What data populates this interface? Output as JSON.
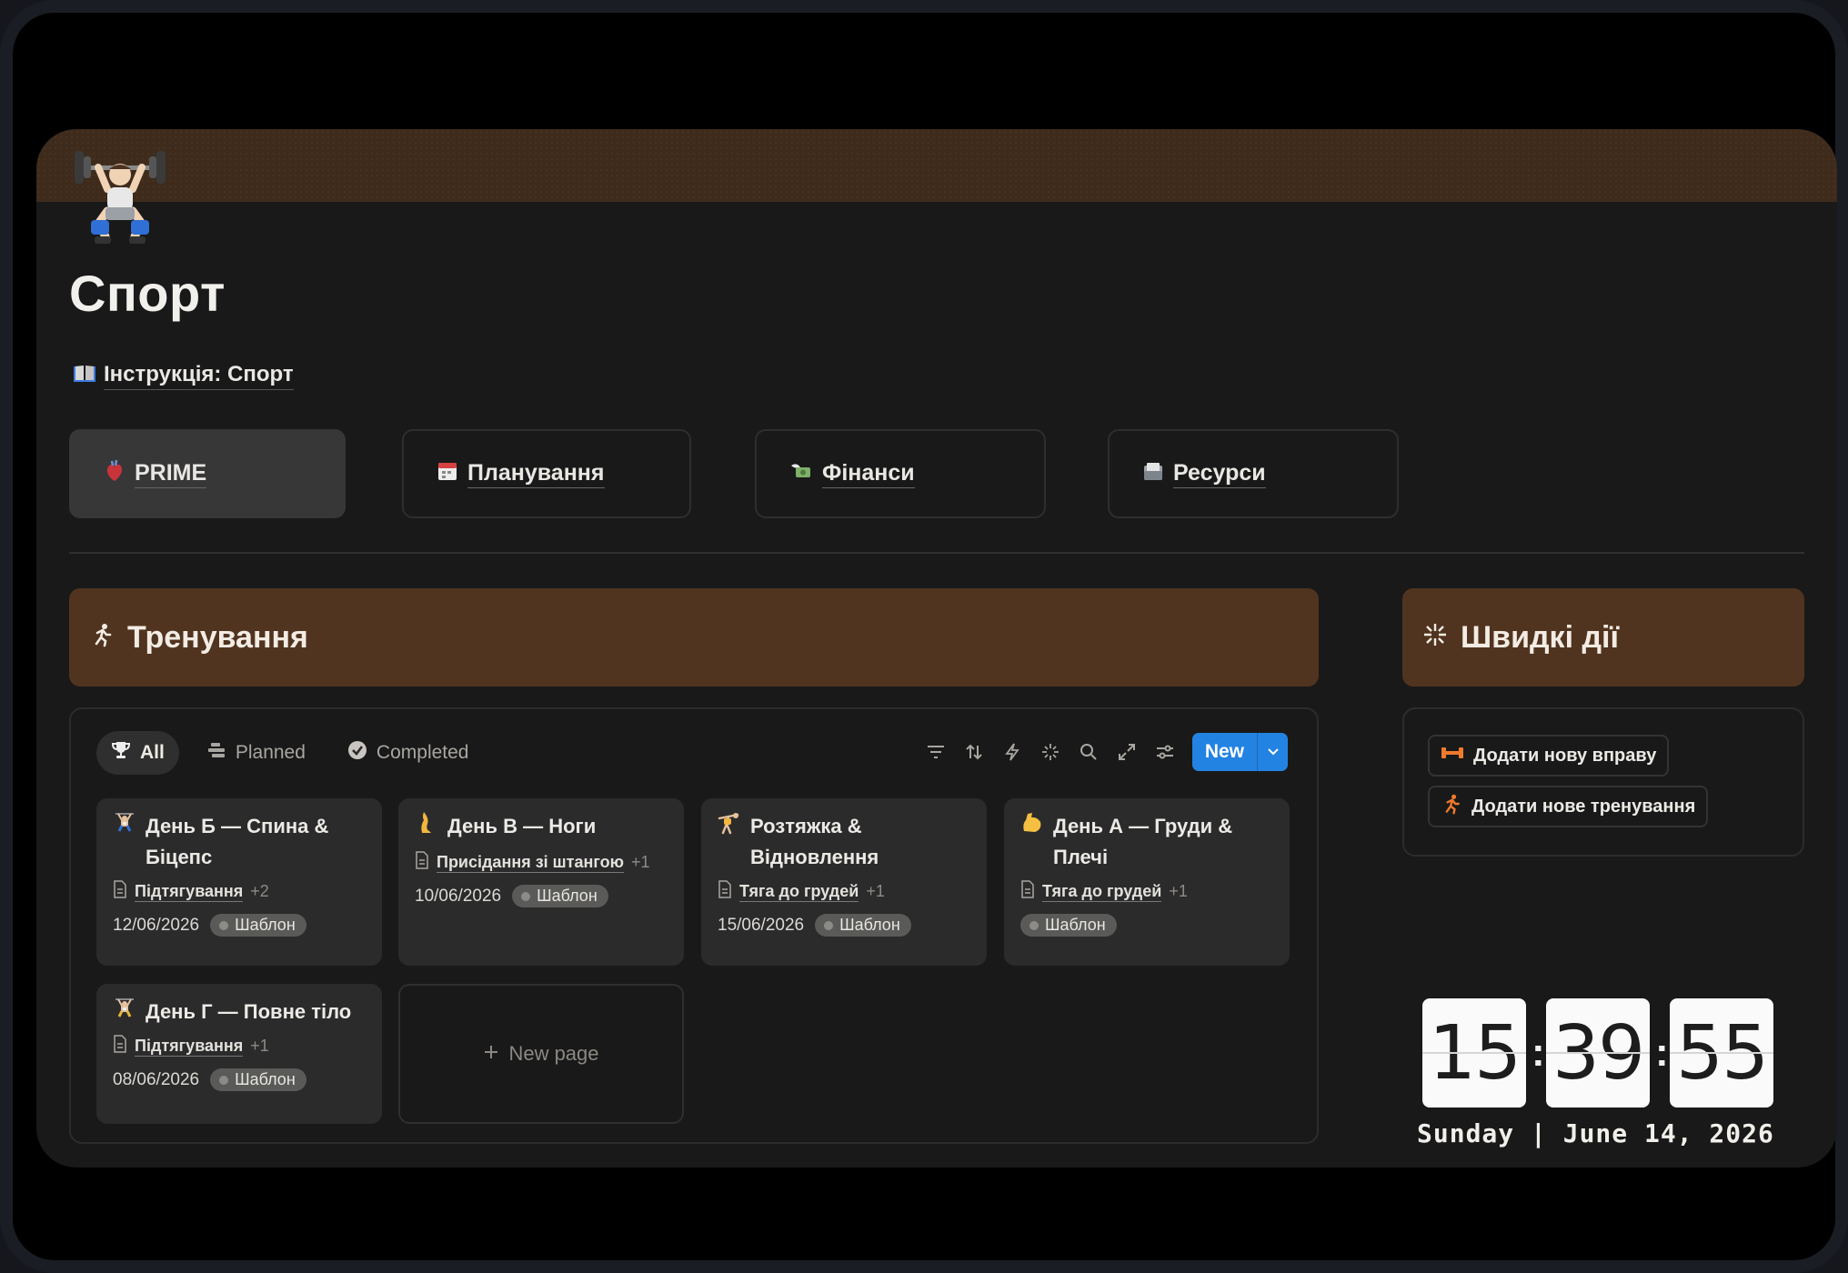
{
  "page": {
    "title": "Спорт",
    "icon": "weightlifter-icon",
    "instruction_link": "Інструкція: Спорт"
  },
  "nav": [
    {
      "label": "PRIME",
      "icon": "anatomical-heart-icon",
      "active": true
    },
    {
      "label": "Планування",
      "icon": "calendar-icon",
      "active": false
    },
    {
      "label": "Фінанси",
      "icon": "money-wings-icon",
      "active": false
    },
    {
      "label": "Ресурси",
      "icon": "card-index-icon",
      "active": false
    }
  ],
  "workouts": {
    "header": "Тренування",
    "header_color": "#51341f",
    "tabs": [
      {
        "label": "All",
        "icon": "trophy-icon",
        "active": true
      },
      {
        "label": "Planned",
        "icon": "list-icon",
        "active": false
      },
      {
        "label": "Completed",
        "icon": "check-circle-icon",
        "active": false
      }
    ],
    "new_button": "New",
    "cards": [
      {
        "title": "День Б — Спина & Біцепс",
        "icon": "weightlifter-icon",
        "relation": "Підтягування",
        "more": "+2",
        "date": "12/06/2026",
        "tag": "Шаблон"
      },
      {
        "title": "День В — Ноги",
        "icon": "leg-icon",
        "relation": "Присідання зі штангою",
        "more": "+1",
        "date": "10/06/2026",
        "tag": "Шаблон"
      },
      {
        "title": "Розтяжка & Відновлення",
        "icon": "cartwheel-icon",
        "relation": "Тяга до грудей",
        "more": "+1",
        "date": "15/06/2026",
        "tag": "Шаблон"
      },
      {
        "title": "День А — Груди & Плечі",
        "icon": "flexed-biceps-icon",
        "relation": "Тяга до грудей",
        "more": "+1",
        "date": "",
        "tag": "Шаблон"
      },
      {
        "title": "День Г — Повне тіло",
        "icon": "weightlifter-icon",
        "relation": "Підтягування",
        "more": "+1",
        "date": "08/06/2026",
        "tag": "Шаблон"
      }
    ],
    "new_page": "New page"
  },
  "quick_actions": {
    "header": "Швидкі дії",
    "buttons": [
      {
        "label": "Додати нову вправу",
        "icon": "dumbbell-icon"
      },
      {
        "label": "Додати нове тренування",
        "icon": "running-icon"
      }
    ]
  },
  "clock": {
    "hours": "15",
    "minutes": "39",
    "seconds": "55",
    "date_line": "Sunday | June 14, 2026"
  }
}
